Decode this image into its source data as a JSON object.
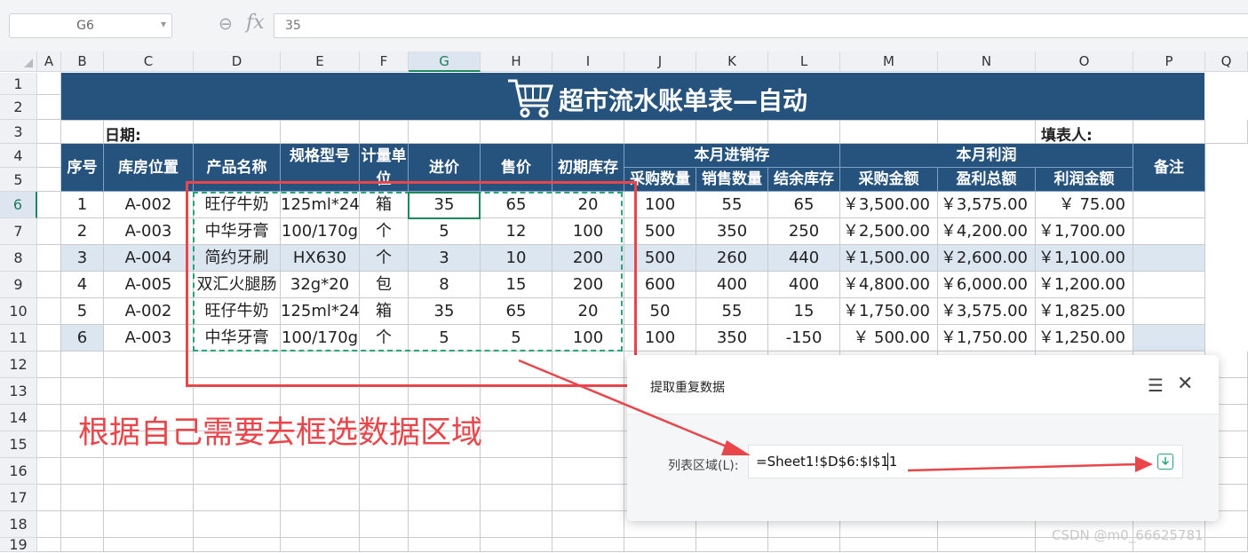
{
  "name_box": {
    "value": "G6"
  },
  "formula_bar": {
    "fx_label": "fx",
    "value": "35"
  },
  "columns": [
    "A",
    "B",
    "C",
    "D",
    "E",
    "F",
    "G",
    "H",
    "I",
    "J",
    "K",
    "L",
    "M",
    "N",
    "O",
    "P",
    "Q"
  ],
  "rows": [
    "1",
    "2",
    "3",
    "4",
    "5",
    "6",
    "7",
    "8",
    "9",
    "10",
    "11",
    "12",
    "13",
    "14",
    "15",
    "16",
    "17",
    "18",
    "19"
  ],
  "sheet": {
    "title": "超市流水账单表—自动",
    "date_label": "日期:",
    "filler_label": "填表人:",
    "headers": {
      "seq": "序号",
      "location": "库房位置",
      "product": "产品名称",
      "spec": "规格型号",
      "unit": "计量单位",
      "buy_price": "进价",
      "sell_price": "售价",
      "init_stock": "初期库存",
      "month_group": "本月进销存",
      "purchase_qty": "采购数量",
      "sales_qty": "销售数量",
      "remain_stock": "结余库存",
      "profit_group": "本月利润",
      "purchase_amt": "采购金额",
      "gross_total": "盈利总额",
      "profit_amt": "利润金额",
      "note": "备注"
    },
    "data": [
      [
        "1",
        "A-002",
        "旺仔牛奶",
        "125ml*24",
        "箱",
        "35",
        "65",
        "20",
        "100",
        "55",
        "65",
        "￥3,500.00",
        "￥3,575.00",
        "￥      75.00",
        ""
      ],
      [
        "2",
        "A-003",
        "中华牙膏",
        "100/170g",
        "个",
        "5",
        "12",
        "100",
        "500",
        "350",
        "250",
        "￥2,500.00",
        "￥4,200.00",
        "￥1,700.00",
        ""
      ],
      [
        "3",
        "A-004",
        "简约牙刷",
        "HX630",
        "个",
        "3",
        "10",
        "200",
        "500",
        "260",
        "440",
        "￥1,500.00",
        "￥2,600.00",
        "￥1,100.00",
        ""
      ],
      [
        "4",
        "A-005",
        "双汇火腿肠",
        "32g*20",
        "包",
        "8",
        "15",
        "200",
        "600",
        "400",
        "400",
        "￥4,800.00",
        "￥6,000.00",
        "￥1,200.00",
        ""
      ],
      [
        "5",
        "A-002",
        "旺仔牛奶",
        "125ml*24",
        "箱",
        "35",
        "65",
        "20",
        "50",
        "55",
        "15",
        "￥1,750.00",
        "￥3,575.00",
        "￥1,825.00",
        ""
      ],
      [
        "6",
        "A-003",
        "中华牙膏",
        "100/170g",
        "个",
        "5",
        "5",
        "100",
        "100",
        "350",
        "-150",
        "￥   500.00",
        "￥1,750.00",
        "￥1,250.00",
        ""
      ]
    ]
  },
  "annotation": "根据自己需要去框选数据区域",
  "dialog": {
    "title": "提取重复数据",
    "field_label": "列表区域(L):",
    "field_value": "=Sheet1!$D$6:$I$11"
  },
  "watermark": "CSDN @m0_66625781"
}
